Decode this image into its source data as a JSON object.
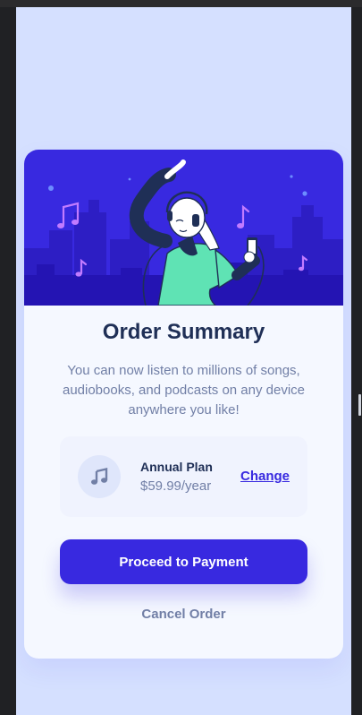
{
  "order": {
    "title": "Order Summary",
    "description": "You can now listen to millions of songs, audiobooks, and podcasts on any device anywhere you like!",
    "plan": {
      "icon": "music-note-icon",
      "name": "Annual Plan",
      "price": "$59.99/year",
      "change_label": "Change"
    },
    "proceed_label": "Proceed to Payment",
    "cancel_label": "Cancel Order"
  },
  "colors": {
    "page_background": "#d5e0ff",
    "card_background": "#f5f8ff",
    "accent": "#3829e0",
    "heading": "#1f2f56",
    "muted_text": "#717fa6",
    "plan_box": "#f0f3fe"
  }
}
